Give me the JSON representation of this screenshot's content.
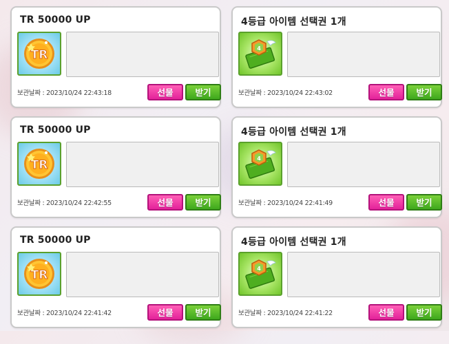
{
  "storage": {
    "date_label": "보관날짜 :",
    "gift_label": "선물",
    "receive_label": "받기",
    "items": [
      {
        "title": "TR 50000 UP",
        "icon": "tr-coin-icon",
        "date": "2023/10/24 22:43:18",
        "message": ""
      },
      {
        "title": "4등급 아이템 선택권 1개",
        "icon": "item-ticket-icon",
        "date": "2023/10/24 22:43:02",
        "message": ""
      },
      {
        "title": "TR 50000 UP",
        "icon": "tr-coin-icon",
        "date": "2023/10/24 22:42:55",
        "message": ""
      },
      {
        "title": "4등급 아이템 선택권 1개",
        "icon": "item-ticket-icon",
        "date": "2023/10/24 22:41:49",
        "message": ""
      },
      {
        "title": "TR 50000 UP",
        "icon": "tr-coin-icon",
        "date": "2023/10/24 22:41:42",
        "message": ""
      },
      {
        "title": "4등급 아이템 선택권 1개",
        "icon": "item-ticket-icon",
        "date": "2023/10/24 22:41:22",
        "message": ""
      }
    ]
  },
  "colors": {
    "gift_button": "#e3229a",
    "receive_button": "#3ea81d",
    "icon_border": "#5aa02c"
  }
}
